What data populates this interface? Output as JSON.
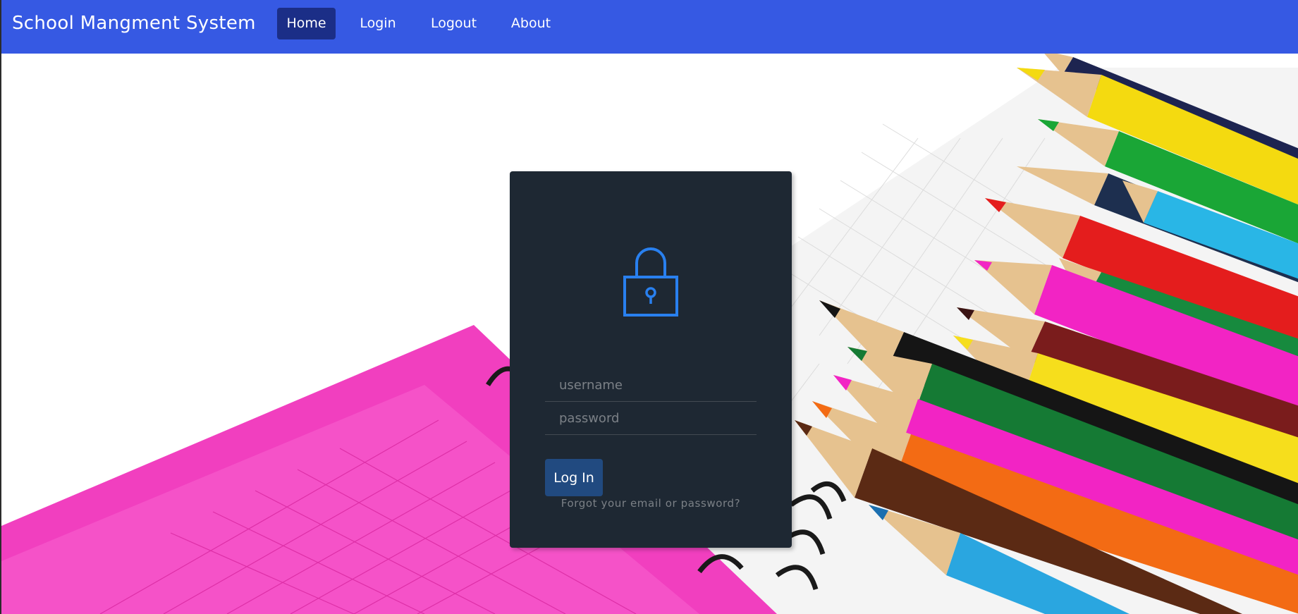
{
  "navbar": {
    "brand": "School Mangment System",
    "links": [
      {
        "label": "Home",
        "active": true
      },
      {
        "label": "Login"
      },
      {
        "label": "Logout"
      },
      {
        "label": "About"
      }
    ],
    "background_color": "#3659e3",
    "active_color": "#1b2e87"
  },
  "login": {
    "icon": "lock-icon",
    "username_placeholder": "username",
    "password_placeholder": "password",
    "submit_label": "Log In",
    "forgot_label": "Forgot your email or password?",
    "card_color": "#1e2833",
    "accent_color": "#2980ef",
    "button_color": "#214a80"
  },
  "background": {
    "description_icon": "pencils-notebook-image"
  }
}
